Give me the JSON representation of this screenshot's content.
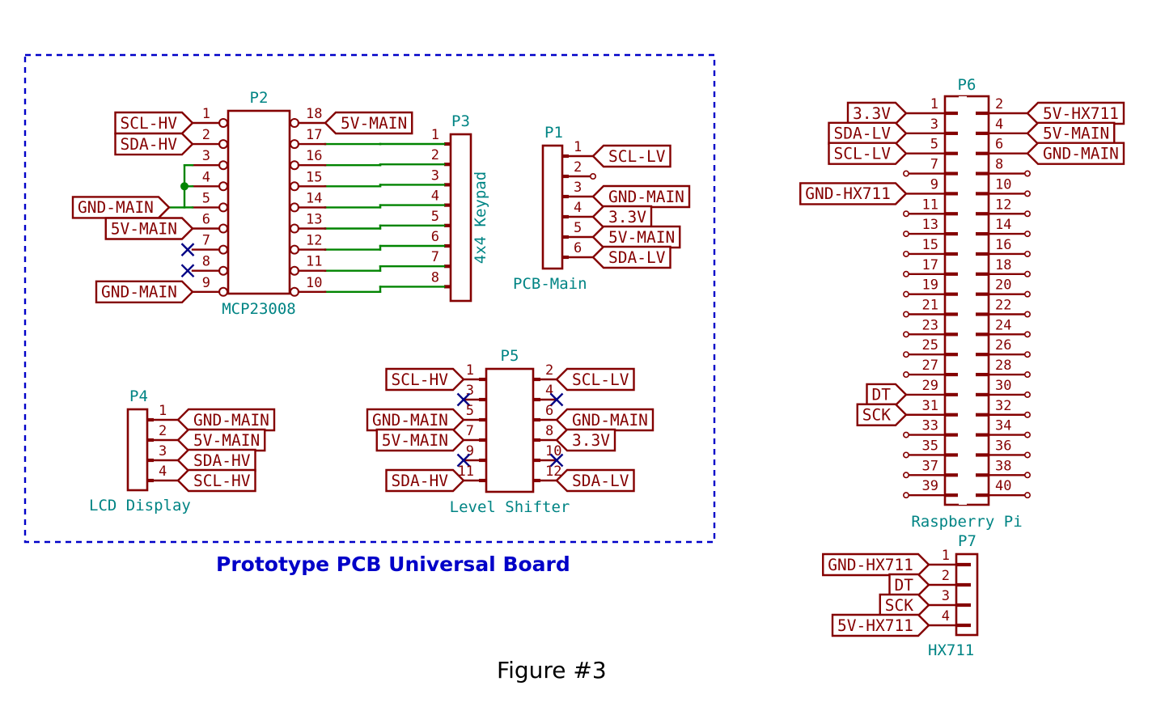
{
  "figure": {
    "caption": "Figure #3",
    "board_title": "Prototype PCB Universal Board"
  },
  "components": {
    "P2": {
      "ref": "P2",
      "value": "MCP23008",
      "left_pins": [
        "1",
        "2",
        "3",
        "4",
        "5",
        "6",
        "7",
        "8",
        "9"
      ],
      "right_pins": [
        "18",
        "17",
        "16",
        "15",
        "14",
        "13",
        "12",
        "11",
        "10"
      ],
      "left_nets": [
        "SCL-HV",
        "SDA-HV",
        "GND-MAIN",
        "GND-MAIN",
        "GND-MAIN",
        "5V-MAIN",
        "",
        "",
        "GND-MAIN"
      ],
      "right_nets": [
        "5V-MAIN",
        "",
        "",
        "",
        "",
        "",
        "",
        "",
        ""
      ],
      "left_nc": [
        "7",
        "8"
      ]
    },
    "P3": {
      "ref": "P3",
      "value": "4x4 Keypad",
      "pins": [
        "1",
        "2",
        "3",
        "4",
        "5",
        "6",
        "7",
        "8"
      ]
    },
    "P1": {
      "ref": "P1",
      "value": "PCB-Main",
      "pins": [
        "1",
        "2",
        "3",
        "4",
        "5",
        "6"
      ],
      "nets": [
        "SCL-LV",
        "",
        "GND-MAIN",
        "3.3V",
        "5V-MAIN",
        "SDA-LV"
      ],
      "nc": [
        "2"
      ]
    },
    "P4": {
      "ref": "P4",
      "value": "LCD Display",
      "pins": [
        "1",
        "2",
        "3",
        "4"
      ],
      "nets": [
        "GND-MAIN",
        "5V-MAIN",
        "SDA-HV",
        "SCL-HV"
      ]
    },
    "P5": {
      "ref": "P5",
      "value": "Level Shifter",
      "left_pins": [
        "1",
        "3",
        "5",
        "7",
        "9",
        "11"
      ],
      "right_pins": [
        "2",
        "4",
        "6",
        "8",
        "10",
        "12"
      ],
      "left_nets": [
        "SCL-HV",
        "",
        "GND-MAIN",
        "5V-MAIN",
        "",
        "SDA-HV"
      ],
      "right_nets": [
        "SCL-LV",
        "",
        "GND-MAIN",
        "3.3V",
        "",
        "SDA-LV"
      ],
      "left_nc": [
        "3",
        "9"
      ],
      "right_nc": [
        "4",
        "10"
      ]
    },
    "P6": {
      "ref": "P6",
      "value": "Raspberry Pi",
      "left_pins": [
        "1",
        "3",
        "5",
        "7",
        "9",
        "11",
        "13",
        "15",
        "17",
        "19",
        "21",
        "23",
        "25",
        "27",
        "29",
        "31",
        "33",
        "35",
        "37",
        "39"
      ],
      "right_pins": [
        "2",
        "4",
        "6",
        "8",
        "10",
        "12",
        "14",
        "16",
        "18",
        "20",
        "22",
        "24",
        "26",
        "28",
        "30",
        "32",
        "34",
        "36",
        "38",
        "40"
      ],
      "left_nets": [
        "3.3V",
        "SDA-LV",
        "SCL-LV",
        "",
        "GND-HX711",
        "",
        "",
        "",
        "",
        "",
        "",
        "",
        "",
        "",
        "DT",
        "SCK",
        "",
        "",
        "",
        ""
      ],
      "right_nets": [
        "5V-HX711",
        "5V-MAIN",
        "GND-MAIN",
        "",
        "",
        "",
        "",
        "",
        "",
        "",
        "",
        "",
        "",
        "",
        "",
        "",
        "",
        "",
        "",
        ""
      ]
    },
    "P7": {
      "ref": "P7",
      "value": "HX711",
      "pins": [
        "1",
        "2",
        "3",
        "4"
      ],
      "nets": [
        "GND-HX711",
        "DT",
        "SCK",
        "5V-HX711"
      ]
    }
  },
  "colors": {
    "wire": "#840000",
    "wire_bus": "#008400",
    "reference": "#008484",
    "no_connect": "#000084",
    "board_outline": "#0000c8",
    "caption": "#000000"
  }
}
